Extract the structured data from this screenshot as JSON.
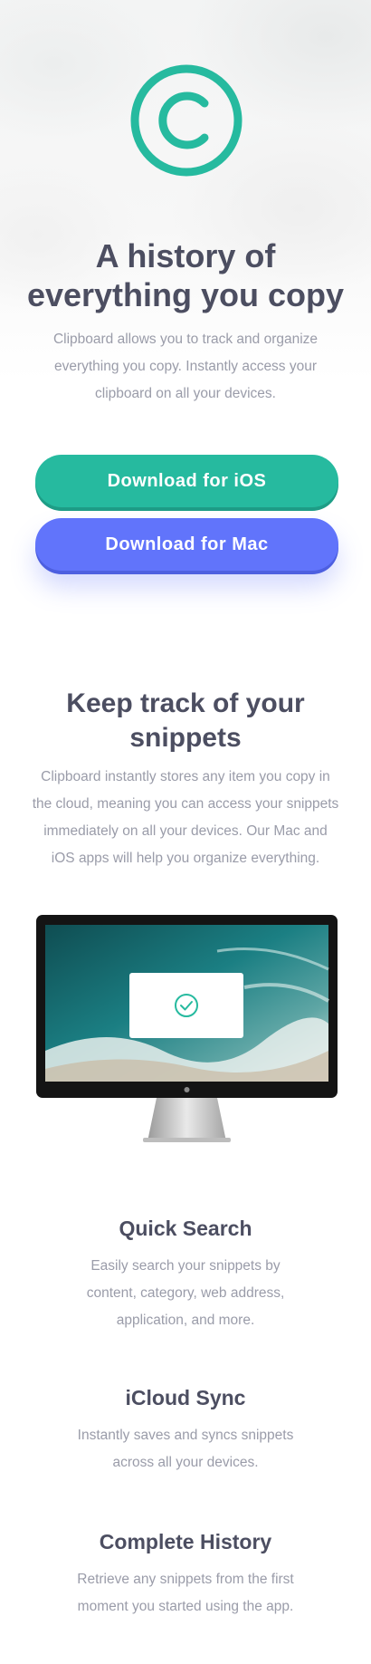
{
  "hero": {
    "logo_icon": "copyright-c-icon",
    "title_line1": "A history of",
    "title_line2": "everything you copy",
    "description_line1": "Clipboard allows you to track and organize",
    "description_line2": "everything you copy. Instantly access your",
    "description_line3": "clipboard on all your devices.",
    "btn_ios": "Download for iOS",
    "btn_mac": "Download for Mac"
  },
  "snippets": {
    "title_line1": "Keep track of your",
    "title_line2": "snippets",
    "description_line1": "Clipboard instantly stores any item you copy in",
    "description_line2": "the cloud, meaning you can access your snippets",
    "description_line3": "immediately on all your devices. Our Mac and",
    "description_line4": "iOS apps will help you organize everything.",
    "monitor_icon": "checkmark-circle-icon"
  },
  "features": [
    {
      "title": "Quick Search",
      "line1": "Easily search your snippets by",
      "line2": "content, category, web address,",
      "line3": "application, and more."
    },
    {
      "title": "iCloud Sync",
      "line1": "Instantly saves and syncs snippets",
      "line2": "across all your devices."
    },
    {
      "title": "Complete History",
      "line1": "Retrieve any snippets from the first",
      "line2": "moment you started using the app."
    }
  ],
  "colors": {
    "accent_green": "#26ba9f",
    "accent_blue": "#6174fb",
    "heading": "#4c4e61",
    "body_text": "#9a9ca9"
  }
}
